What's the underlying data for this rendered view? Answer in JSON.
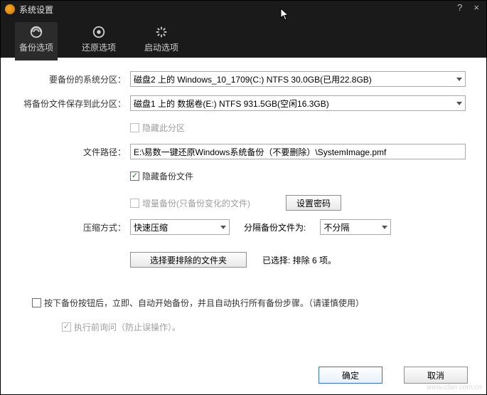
{
  "window": {
    "title": "系统设置"
  },
  "tabs": [
    {
      "label": "备份选项"
    },
    {
      "label": "还原选项"
    },
    {
      "label": "启动选项"
    }
  ],
  "form": {
    "source_label": "要备份的系统分区：",
    "source_value": "磁盘2 上的 Windows_10_1709(C:) NTFS 30.0GB(已用22.8GB)",
    "dest_label": "将备份文件保存到此分区：",
    "dest_value": "磁盘1 上的 数据卷(E:) NTFS 931.5GB(空闲16.3GB)",
    "hide_partition_label": "隐藏此分区",
    "path_label": "文件路径：",
    "path_value": "E:\\易数一键还原Windows系统备份（不要删除）\\SystemImage.pmf",
    "hide_backup_label": "隐藏备份文件",
    "incremental_label": "增量备份(只备份变化的文件)",
    "set_password_btn": "设置密码",
    "compression_label": "压缩方式：",
    "compression_value": "快速压缩",
    "split_label": "分隔备份文件为:",
    "split_value": "不分隔",
    "exclude_btn": "选择要排除的文件夹",
    "exclude_status": "已选择: 排除 6 项。",
    "autostart_label": "按下备份按钮后，立即、自动开始备份，并且自动执行所有备份步骤。（请谨慎使用）",
    "preconfirm_label": "执行前询问（防止误操作）。"
  },
  "footer": {
    "ok": "确定",
    "cancel": "取消"
  },
  "watermark": "www.cfan.com.cn"
}
